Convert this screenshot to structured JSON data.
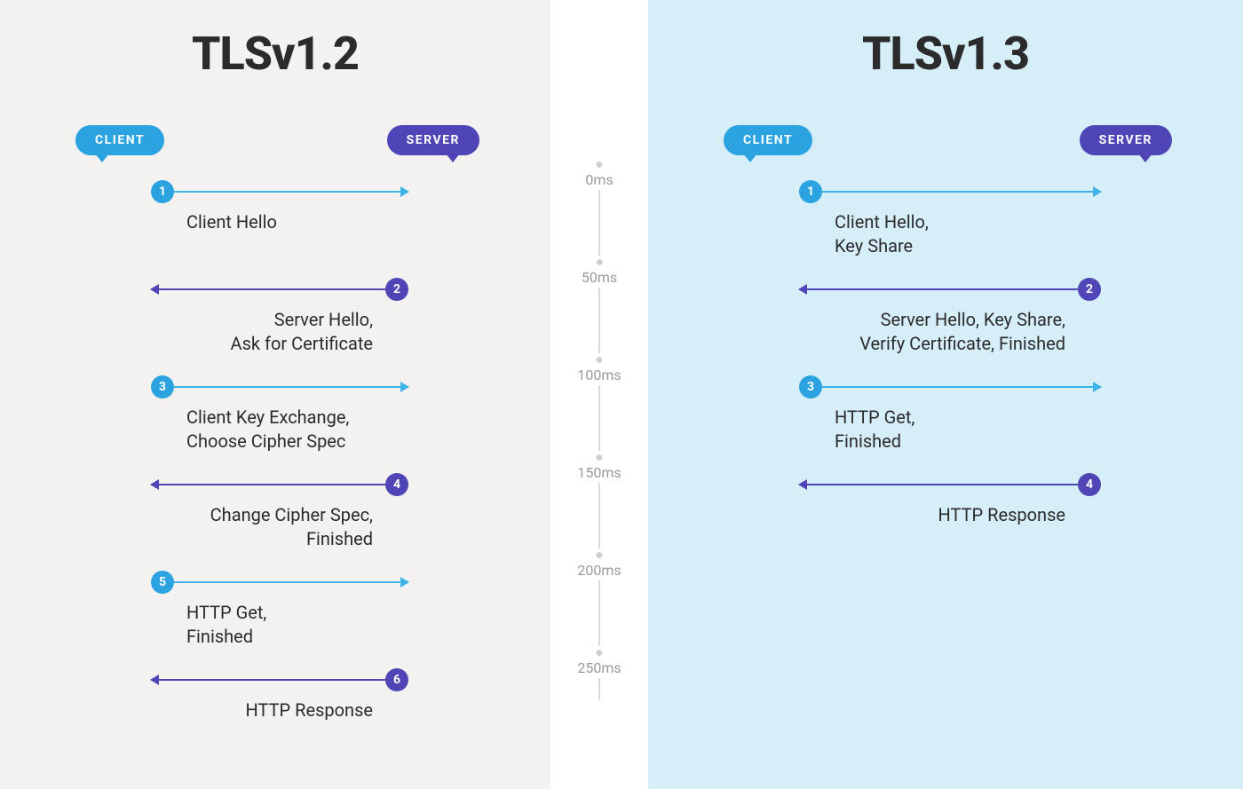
{
  "colors": {
    "client": "#2aa3e0",
    "server": "#4f45b6",
    "panel_left_bg": "#f3f2f1",
    "panel_right_bg": "#d6eef8"
  },
  "timeline": {
    "unit": "ms",
    "ticks": [
      {
        "value": 0,
        "label": "0ms"
      },
      {
        "value": 50,
        "label": "50ms"
      },
      {
        "value": 100,
        "label": "100ms"
      },
      {
        "value": 150,
        "label": "150ms"
      },
      {
        "value": 200,
        "label": "200ms"
      },
      {
        "value": 250,
        "label": "250ms"
      }
    ]
  },
  "left": {
    "title": "TLSv1.2",
    "client_label": "CLIENT",
    "server_label": "SERVER",
    "steps": [
      {
        "n": "1",
        "dir": "right",
        "time_ms": 0,
        "label": "Client Hello"
      },
      {
        "n": "2",
        "dir": "left",
        "time_ms": 50,
        "label": "Server Hello,\nAsk for Certificate"
      },
      {
        "n": "3",
        "dir": "right",
        "time_ms": 100,
        "label": "Client Key Exchange,\nChoose Cipher Spec"
      },
      {
        "n": "4",
        "dir": "left",
        "time_ms": 150,
        "label": "Change Cipher Spec,\nFinished"
      },
      {
        "n": "5",
        "dir": "right",
        "time_ms": 200,
        "label": "HTTP Get,\nFinished"
      },
      {
        "n": "6",
        "dir": "left",
        "time_ms": 250,
        "label": "HTTP Response"
      }
    ]
  },
  "right": {
    "title": "TLSv1.3",
    "client_label": "CLIENT",
    "server_label": "SERVER",
    "steps": [
      {
        "n": "1",
        "dir": "right",
        "time_ms": 0,
        "label": "Client Hello,\nKey Share"
      },
      {
        "n": "2",
        "dir": "left",
        "time_ms": 50,
        "label": "Server Hello, Key Share,\nVerify Certificate, Finished"
      },
      {
        "n": "3",
        "dir": "right",
        "time_ms": 100,
        "label": "HTTP Get,\nFinished"
      },
      {
        "n": "4",
        "dir": "left",
        "time_ms": 150,
        "label": "HTTP Response"
      }
    ]
  }
}
